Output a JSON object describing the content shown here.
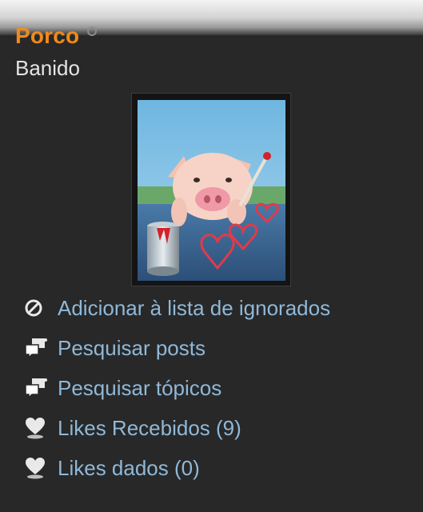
{
  "profile": {
    "username": "Porco",
    "status_icon": "offline-status-icon",
    "user_title": "Banido",
    "avatar_icon": "pig-avatar-image"
  },
  "actions": [
    {
      "label": "Adicionar à lista de ignorados",
      "icon": "ignore-icon"
    },
    {
      "label": "Pesquisar posts",
      "icon": "search-posts-icon"
    },
    {
      "label": "Pesquisar tópicos",
      "icon": "search-topics-icon"
    },
    {
      "label": "Likes Recebidos (9)",
      "icon": "heart-user-icon"
    },
    {
      "label": "Likes dados (0)",
      "icon": "heart-user-icon"
    }
  ],
  "colors": {
    "background": "#282828",
    "username": "#f08a1c",
    "link": "#8fb8d8",
    "title_text": "#e4e4e4"
  }
}
